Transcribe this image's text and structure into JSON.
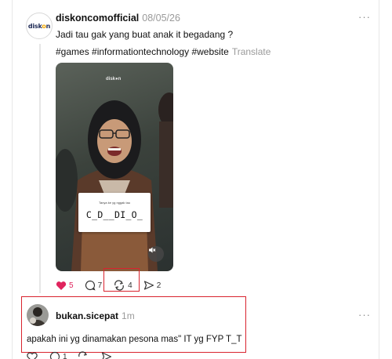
{
  "post1": {
    "username": "diskoncomofficial",
    "time": "08/05/26",
    "text": "Jadi tau gak yang buat anak it begadang ?",
    "hashtags": "#games #informationtechnology #website",
    "translate_label": "Translate",
    "avatar_logo": {
      "part1": "disk",
      "part2": "o",
      "part3": "n"
    },
    "video": {
      "watermark": "disk●n",
      "card_caption": "Tanya ke yg nggak tau",
      "card_word": "C_D__DI_O_"
    },
    "actions": {
      "likes": "5",
      "comments": "7",
      "reposts": "4",
      "shares": "2"
    },
    "like_color": "#e0245e"
  },
  "post2": {
    "username": "bukan.sicepat",
    "time": "1m",
    "text": "apakah ini yg dinamakan pesona mas\" IT yg FYP T_T",
    "actions": {
      "comments": "1"
    }
  },
  "more_label": "···",
  "highlight_color": "#d9232e"
}
